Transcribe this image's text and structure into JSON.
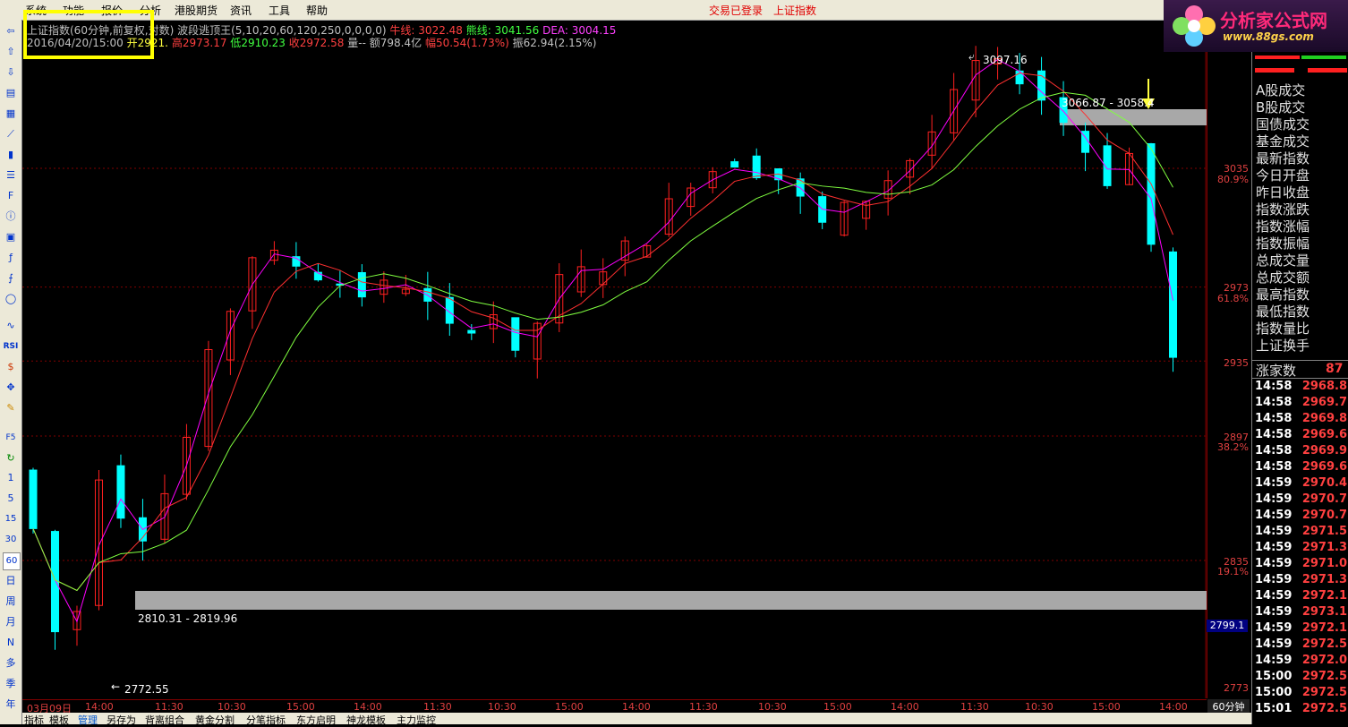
{
  "menu": [
    "系统",
    "功能",
    "报价",
    "分析",
    "港股期货",
    "资讯",
    "工具",
    "帮助"
  ],
  "status": {
    "login": "交易已登录",
    "index": "上证指数"
  },
  "logo": {
    "text": "分析家公式网",
    "sub": "www.88gs.com"
  },
  "header": {
    "title": "上证指数(60分钟,前复权,对数)",
    "indicator": "波段逃顶王(5,10,20,60,120,250,0,0,0,0)",
    "niu_label": "牛线:",
    "niu": "3022.48",
    "xiong_label": "熊线:",
    "xiong": "3041.56",
    "dea_label": "DEA:",
    "dea": "3004.15",
    "date": "2016/04/20/15:00",
    "open_label": "开",
    "open": "2921.",
    "high_label": "高",
    "high": "2973.17",
    "low_label": "低",
    "low": "2910.23",
    "close_label": "收",
    "close": "2972.58",
    "vol_label": "量--",
    "amount_label": "额",
    "amount": "798.4亿",
    "change_label": "幅",
    "change": "50.54(1.73%)",
    "amp_label": "振",
    "amp": "62.94(2.15%)"
  },
  "annotations": {
    "peak": "3097.16",
    "resistance": "3066.87 - 3058.4",
    "support": "2810.31 - 2819.96",
    "low": "2772.55"
  },
  "price_axis": [
    {
      "price": "3035",
      "pct": "80.9%"
    },
    {
      "price": "2973",
      "pct": "61.8%"
    },
    {
      "price": "2935",
      "pct": ""
    },
    {
      "price": "2897",
      "pct": "38.2%"
    },
    {
      "price": "2835",
      "pct": "19.1%"
    },
    {
      "price": "2773",
      "pct": ""
    }
  ],
  "current_price": "2799.1",
  "time_axis": [
    "03月09日",
    "14:00",
    "11:30",
    "10:30",
    "15:00",
    "14:00",
    "11:30",
    "10:30",
    "15:00",
    "14:00",
    "11:30",
    "10:30",
    "15:00",
    "14:00",
    "11:30",
    "10:30",
    "15:00",
    "14:00"
  ],
  "period": "60分钟",
  "bottom_tabs": [
    "指标",
    "模板",
    "管理",
    "另存为",
    "背离组合",
    "黄金分割",
    "分笔指标",
    "东方启明",
    "神龙模板",
    "主力监控"
  ],
  "right_panel": {
    "labels": [
      "A股成交",
      "B股成交",
      "国债成交",
      "基金成交",
      "最新指数",
      "今日开盘",
      "昨日收盘",
      "指数涨跌",
      "指数涨幅",
      "指数振幅",
      "总成交量",
      "总成交额",
      "最高指数",
      "最低指数",
      "指数量比",
      "上证换手"
    ],
    "rise_label": "涨家数",
    "rise_value": "87",
    "ticks": [
      {
        "t": "14:58",
        "v": "2968.8"
      },
      {
        "t": "14:58",
        "v": "2969.7"
      },
      {
        "t": "14:58",
        "v": "2969.8"
      },
      {
        "t": "14:58",
        "v": "2969.6"
      },
      {
        "t": "14:58",
        "v": "2969.9"
      },
      {
        "t": "14:58",
        "v": "2969.6"
      },
      {
        "t": "14:59",
        "v": "2970.4"
      },
      {
        "t": "14:59",
        "v": "2970.7"
      },
      {
        "t": "14:59",
        "v": "2970.7"
      },
      {
        "t": "14:59",
        "v": "2971.5"
      },
      {
        "t": "14:59",
        "v": "2971.3"
      },
      {
        "t": "14:59",
        "v": "2971.0"
      },
      {
        "t": "14:59",
        "v": "2971.3"
      },
      {
        "t": "14:59",
        "v": "2972.1"
      },
      {
        "t": "14:59",
        "v": "2973.1"
      },
      {
        "t": "14:59",
        "v": "2972.1"
      },
      {
        "t": "14:59",
        "v": "2972.5"
      },
      {
        "t": "14:59",
        "v": "2972.0"
      },
      {
        "t": "15:00",
        "v": "2972.5"
      },
      {
        "t": "15:00",
        "v": "2972.5"
      },
      {
        "t": "15:01",
        "v": "2972.5"
      }
    ]
  },
  "toolbar": [
    "1",
    "5",
    "15",
    "30",
    "60",
    "日",
    "周",
    "月",
    "N",
    "多",
    "季",
    "年"
  ],
  "colors": {
    "up": "#ff2020",
    "down": "#00ffff",
    "ma5": "#ff00ff",
    "ma10": "#ff3030",
    "ma20": "#80ff40",
    "grid": "#800000"
  }
}
